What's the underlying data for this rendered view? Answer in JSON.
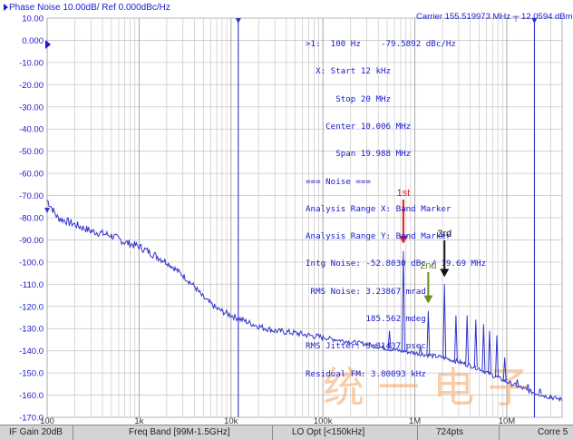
{
  "header": {
    "title": "Phase Noise 10.00dB/ Ref 0.000dBc/Hz",
    "carrier": "Carrier 155.519973 MHz",
    "carrier_power": "12.0594 dBm"
  },
  "marker_info": [
    ">1:  100 Hz    -79.5892 dBc/Hz",
    "  X: Start 12 kHz",
    "      Stop 20 MHz",
    "    Center 10.006 MHz",
    "      Span 19.988 MHz",
    "=== Noise ===",
    "Analysis Range X: Band Marker",
    "Analysis Range Y: Band Marker",
    "Intg Noise: -52.8030 dBc / 19.69 MHz",
    " RMS Noise: 3.23867 mrad",
    "            185.562 mdeg",
    "RMS Jitter: 3.31437 psec",
    "Residual FM: 3.80093 kHz"
  ],
  "status_bar": {
    "if_gain": "IF Gain 20dB",
    "freq_band": "Freq Band [99M-1.5GHz]",
    "lo_opt": "LO Opt [<150kHz]",
    "points": "724pts",
    "corr": "Corre 5"
  },
  "annotations": {
    "first": "1st",
    "second": "2nd",
    "third": "3rd"
  },
  "colors": {
    "trace": "#3333cc",
    "grid": "#c8c8c8",
    "text": "#1a1ad0",
    "first_arrow": "#e02020",
    "second_arrow": "#6b8e23",
    "third_arrow": "#111111",
    "watermark": "#f4a460"
  },
  "watermark": "统 一 电 子",
  "chart_data": {
    "type": "line",
    "title": "Phase Noise 10.00dB/ Ref 0.000dBc/Hz",
    "xscale": "log",
    "xlim": [
      100,
      40000000
    ],
    "ylim": [
      -170,
      10
    ],
    "yticks": [
      10,
      0,
      -10,
      -20,
      -30,
      -40,
      -50,
      -60,
      -70,
      -80,
      -90,
      -100,
      -110,
      -120,
      -130,
      -140,
      -150,
      -160,
      -170
    ],
    "ytick_labels": [
      "10.00",
      "0.000",
      "-10.00",
      "-20.00",
      "-30.00",
      "-40.00",
      "-50.00",
      "-60.00",
      "-70.00",
      "-80.00",
      "-90.00",
      "-100.0",
      "-110.0",
      "-120.0",
      "-130.0",
      "-140.0",
      "-150.0",
      "-160.0",
      "-170.0"
    ],
    "xticks": [
      100,
      1000,
      10000,
      100000,
      1000000,
      10000000
    ],
    "xtick_labels": [
      "100",
      "1k",
      "10k",
      "100k",
      "1M",
      "10M"
    ],
    "markers": {
      "marker1": {
        "x": 100,
        "y": -79.5892
      },
      "band_start": 12000,
      "band_stop": 20000000
    },
    "grid": true,
    "series": [
      {
        "baseline": [
          [
            100,
            -72
          ],
          [
            130,
            -80
          ],
          [
            200,
            -83
          ],
          [
            300,
            -86
          ],
          [
            500,
            -88
          ],
          [
            700,
            -91
          ],
          [
            1000,
            -93
          ],
          [
            1500,
            -97
          ],
          [
            2000,
            -100
          ],
          [
            3000,
            -106
          ],
          [
            4000,
            -111
          ],
          [
            5000,
            -116
          ],
          [
            7000,
            -121
          ],
          [
            10000,
            -124
          ],
          [
            15000,
            -127
          ],
          [
            20000,
            -129
          ],
          [
            30000,
            -131
          ],
          [
            50000,
            -132
          ],
          [
            70000,
            -133
          ],
          [
            100000,
            -134
          ],
          [
            200000,
            -136
          ],
          [
            300000,
            -137
          ],
          [
            500000,
            -139
          ],
          [
            700000,
            -140
          ],
          [
            1000000,
            -141
          ],
          [
            2000000,
            -143
          ],
          [
            3000000,
            -145
          ],
          [
            5000000,
            -148
          ],
          [
            7000000,
            -151
          ],
          [
            10000000,
            -154
          ],
          [
            15000000,
            -157
          ],
          [
            20000000,
            -159
          ],
          [
            30000000,
            -161
          ],
          [
            40000000,
            -162
          ]
        ],
        "spurs": [
          {
            "x": 380000,
            "y": -137
          },
          {
            "x": 530000,
            "y": -131
          },
          {
            "x": 750000,
            "y": -95
          },
          {
            "x": 1150000,
            "y": -138
          },
          {
            "x": 1400000,
            "y": -122
          },
          {
            "x": 2100000,
            "y": -110
          },
          {
            "x": 2800000,
            "y": -124
          },
          {
            "x": 3700000,
            "y": -124
          },
          {
            "x": 4600000,
            "y": -126
          },
          {
            "x": 5600000,
            "y": -128
          },
          {
            "x": 6500000,
            "y": -131
          },
          {
            "x": 7800000,
            "y": -133
          },
          {
            "x": 9500000,
            "y": -143
          },
          {
            "x": 13000000,
            "y": -153
          },
          {
            "x": 17000000,
            "y": -155
          },
          {
            "x": 23000000,
            "y": -157
          },
          {
            "x": 30000000,
            "y": -160
          }
        ]
      }
    ]
  }
}
